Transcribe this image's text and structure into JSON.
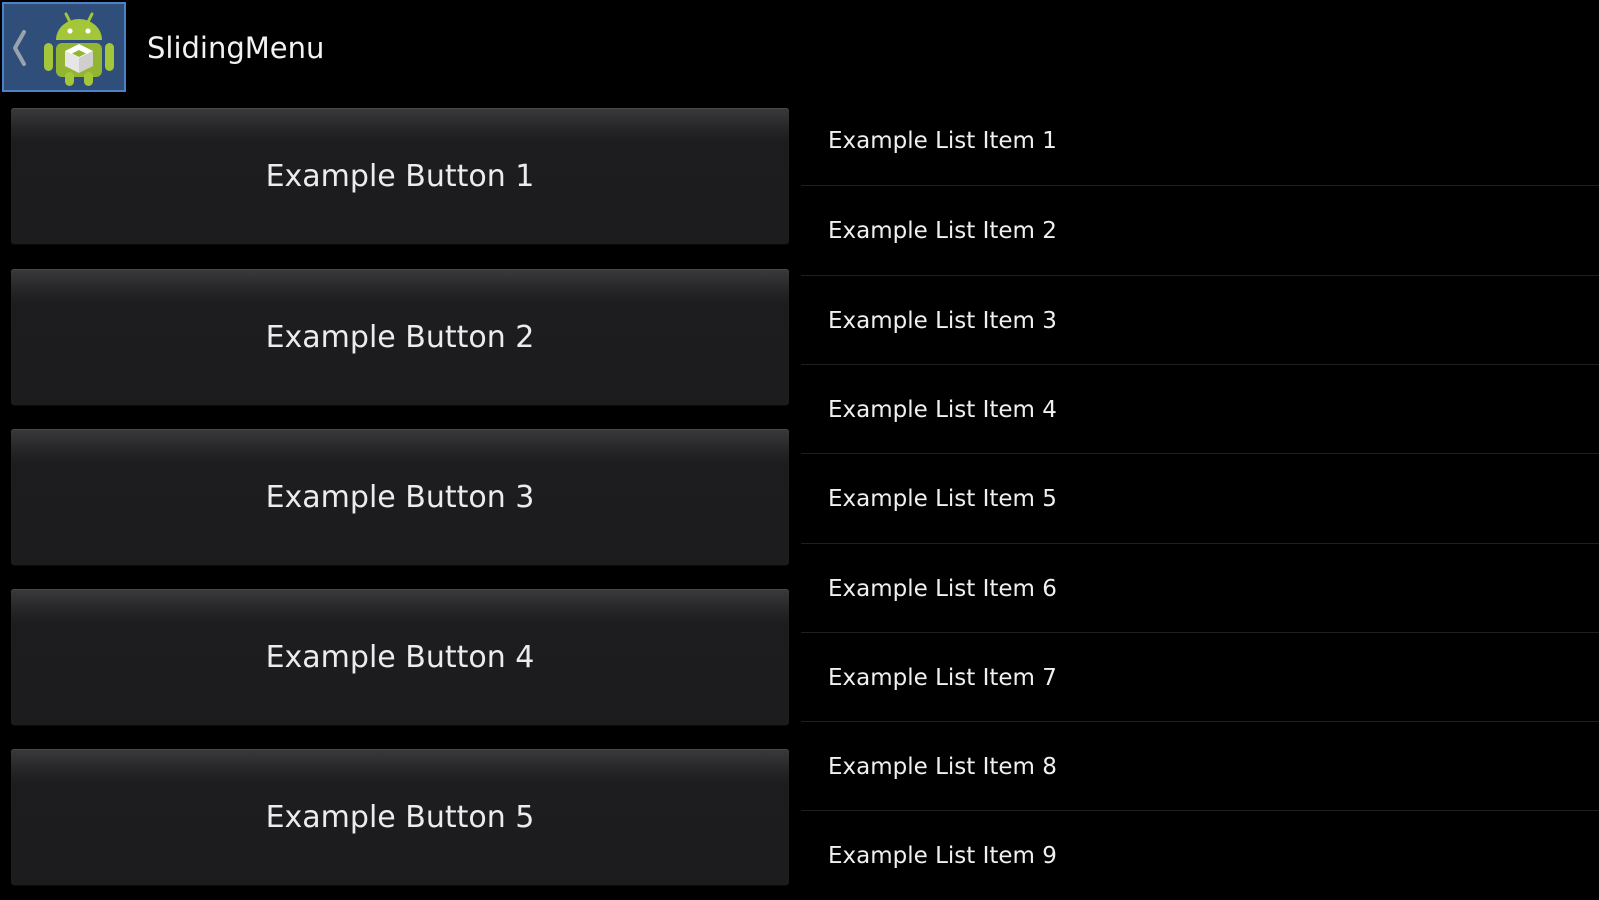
{
  "action_bar": {
    "title": "SlidingMenu",
    "up_icon": "chevron-left-icon",
    "app_icon": "android-robot-icon",
    "colors": {
      "home_highlight_bg": "#2f4f7a",
      "home_highlight_border": "#4d82c9"
    }
  },
  "buttons": [
    {
      "label": "Example Button 1"
    },
    {
      "label": "Example Button 2"
    },
    {
      "label": "Example Button 3"
    },
    {
      "label": "Example Button 4"
    },
    {
      "label": "Example Button 5"
    }
  ],
  "list_items": [
    {
      "label": "Example List Item 1"
    },
    {
      "label": "Example List Item 2"
    },
    {
      "label": "Example List Item 3"
    },
    {
      "label": "Example List Item 4"
    },
    {
      "label": "Example List Item 5"
    },
    {
      "label": "Example List Item 6"
    },
    {
      "label": "Example List Item 7"
    },
    {
      "label": "Example List Item 8"
    },
    {
      "label": "Example List Item 9"
    }
  ]
}
